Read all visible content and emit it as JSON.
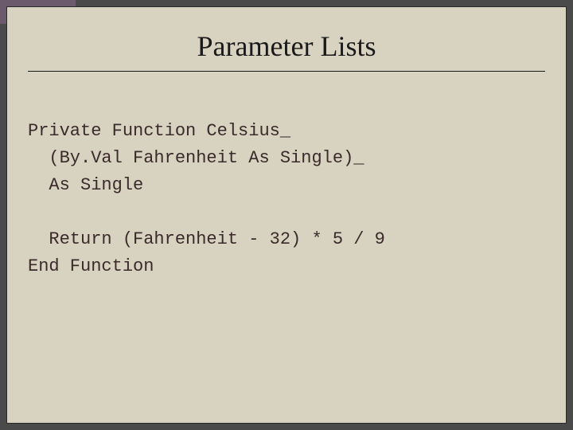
{
  "title": "Parameter Lists",
  "code": {
    "line1": "Private Function Celsius_",
    "line2": "  (By.Val Fahrenheit As Single)_",
    "line3": "  As Single",
    "line4": "  Return (Fahrenheit - 32) * 5 / 9",
    "line5": "End Function"
  }
}
